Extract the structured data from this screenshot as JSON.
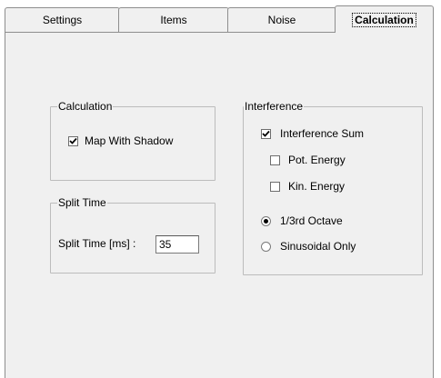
{
  "tabs": [
    {
      "label": "Settings"
    },
    {
      "label": "Items"
    },
    {
      "label": "Noise"
    },
    {
      "label": "Calculation",
      "active": true
    }
  ],
  "calculation_group": {
    "title": "Calculation",
    "map_with_shadow": {
      "label": "Map With Shadow",
      "checked": true
    }
  },
  "split_time_group": {
    "title": "Split Time",
    "label": "Split Time [ms] :",
    "value": "35"
  },
  "interference_group": {
    "title": "Interference",
    "interference_sum": {
      "label": "Interference Sum",
      "checked": true
    },
    "pot_energy": {
      "label": "Pot. Energy",
      "checked": false
    },
    "kin_energy": {
      "label": "Kin. Energy",
      "checked": false
    },
    "octave": {
      "label": "1/3rd Octave",
      "selected": true
    },
    "sinusoidal": {
      "label": "Sinusoidal Only",
      "selected": false
    }
  }
}
